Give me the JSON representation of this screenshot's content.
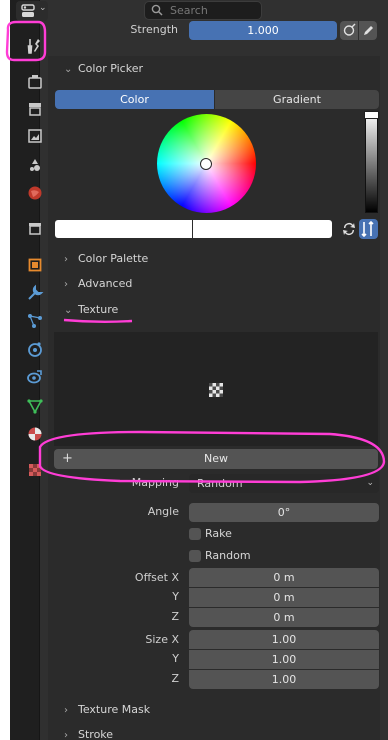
{
  "header": {
    "search_placeholder": "Search"
  },
  "strength": {
    "label": "Strength",
    "value": "1.000"
  },
  "color_picker": {
    "title": "Color Picker",
    "modes": [
      "Color",
      "Gradient"
    ],
    "active_mode": "Color",
    "current_color": "#ffffff",
    "previous_color": "#ffffff",
    "value_level": 1.0
  },
  "panels": {
    "color_palette": "Color Palette",
    "advanced": "Advanced",
    "texture": "Texture",
    "texture_mask": "Texture Mask",
    "stroke": "Stroke"
  },
  "texture": {
    "new_label": "New",
    "mapping_label": "Mapping",
    "mapping_value": "Random",
    "angle_label": "Angle",
    "angle_value": "0°",
    "rake_label": "Rake",
    "random_label": "Random",
    "offset_x_label": "Offset X",
    "offset_y_label": "Y",
    "offset_z_label": "Z",
    "offset_x": "0 m",
    "offset_y": "0 m",
    "offset_z": "0 m",
    "size_x_label": "Size X",
    "size_y_label": "Y",
    "size_z_label": "Z",
    "size_x": "1.00",
    "size_y": "1.00",
    "size_z": "1.00"
  },
  "sidebar_tabs": [
    "tool-icon",
    "render-icon",
    "output-icon",
    "view-layer-icon",
    "scene-icon",
    "world-icon",
    "collection-icon",
    "object-icon",
    "modifier-icon",
    "particles-icon",
    "physics-icon",
    "constraints-icon",
    "data-icon",
    "material-icon",
    "texture-icon"
  ],
  "colors": {
    "accent": "#4772b3",
    "annotation": "#ff3dd6",
    "panel_bg": "#303030"
  }
}
